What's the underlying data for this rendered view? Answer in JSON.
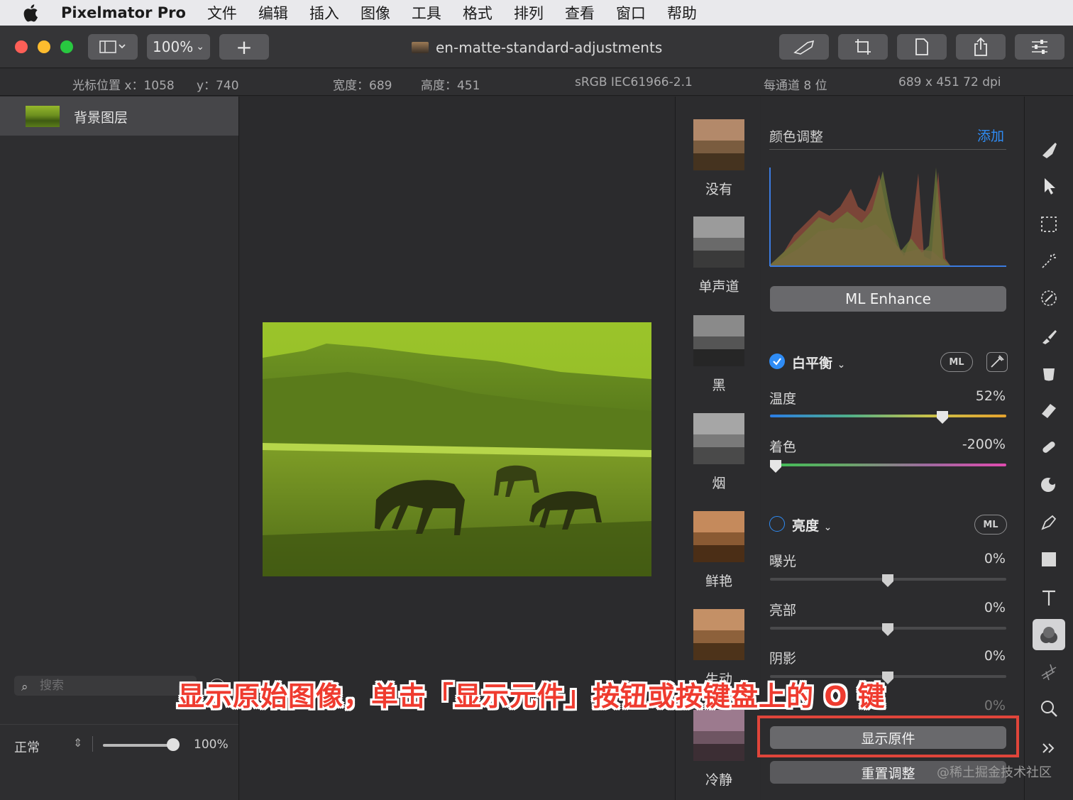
{
  "menubar": {
    "app_name": "Pixelmator Pro",
    "items": [
      "文件",
      "编辑",
      "插入",
      "图像",
      "工具",
      "格式",
      "排列",
      "查看",
      "窗口",
      "帮助"
    ]
  },
  "toolbar": {
    "zoom": "100%",
    "doc_title": "en-matte-standard-adjustments"
  },
  "infobar": {
    "cursor_x": "光标位置 x：1058",
    "cursor_y": "y：740",
    "width": "宽度：689",
    "height": "高度：451",
    "profile": "sRGB IEC61966-2.1",
    "bits": "每通道 8 位",
    "dims": "689 x 451 72 dpi"
  },
  "sidebar": {
    "layer_name": "背景图层",
    "blend_mode": "正常",
    "opacity": "100%",
    "search_placeholder": "搜索"
  },
  "presets": [
    "没有",
    "单声道",
    "黑",
    "烟",
    "鲜艳",
    "生动",
    "冷静"
  ],
  "adjustments": {
    "title": "颜色调整",
    "add_label": "添加",
    "ml_enhance": "ML Enhance",
    "white_balance": {
      "title": "白平衡",
      "enabled": true,
      "ml": "ML",
      "temperature_label": "温度",
      "temperature_value": "52%",
      "temperature_level": 0.74,
      "tint_label": "着色",
      "tint_value": "-200%",
      "tint_level": 0.0
    },
    "brightness": {
      "title": "亮度",
      "enabled": false,
      "ml": "ML",
      "exposure_label": "曝光",
      "exposure_value": "0%",
      "highlights_label": "亮部",
      "highlights_value": "0%",
      "shadows_label": "阴影",
      "shadows_value": "0%",
      "hidden_value": "0%"
    },
    "show_original": "显示原件",
    "reset": "重置调整"
  },
  "caption": "显示原始图像，单击「显示元件」按钮或按键盘上的 O 键",
  "watermark": "@稀土掘金技术社区",
  "colors": {
    "accent": "#2f8cf5",
    "highlight": "#e0453a",
    "red_light": "#fe5f57",
    "yellow_light": "#febc2e",
    "green_light": "#28c840"
  }
}
